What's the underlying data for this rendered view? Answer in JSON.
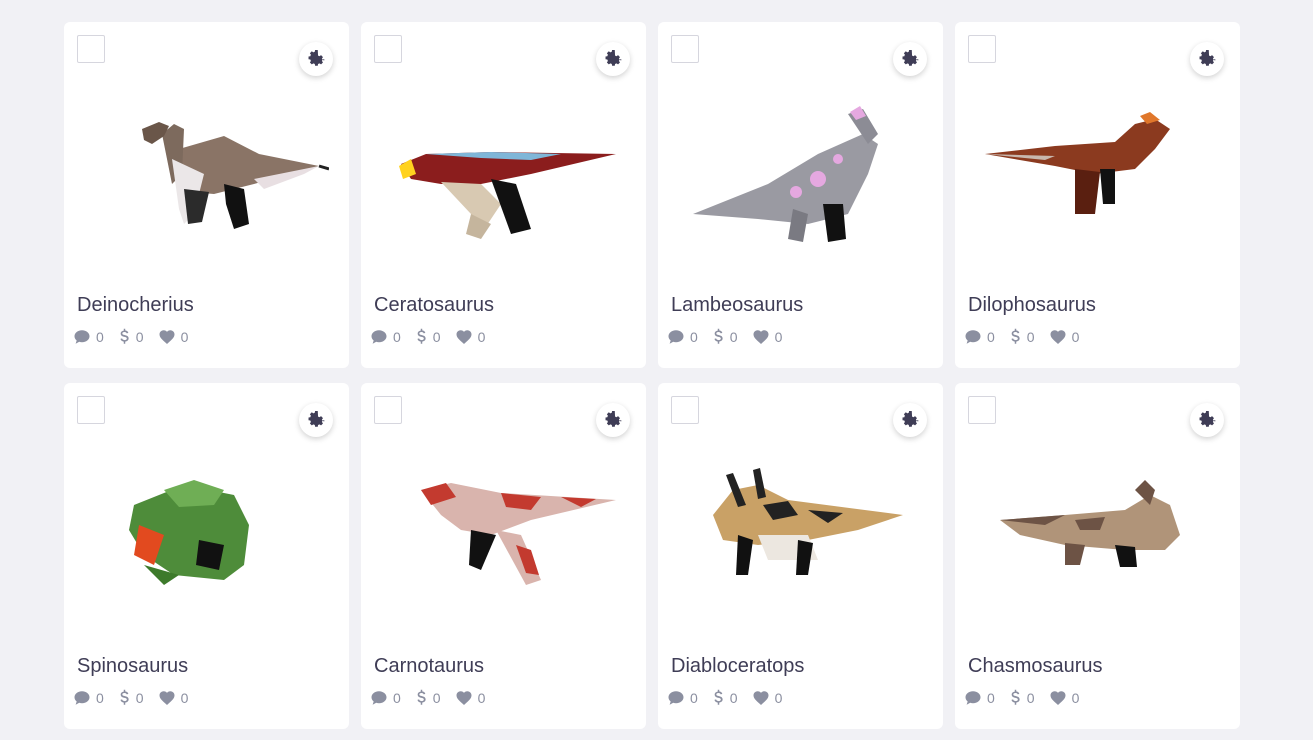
{
  "cards": [
    {
      "name": "Deinocherius",
      "comments": "0",
      "tips": "0",
      "likes": "0"
    },
    {
      "name": "Ceratosaurus",
      "comments": "0",
      "tips": "0",
      "likes": "0"
    },
    {
      "name": "Lambeosaurus",
      "comments": "0",
      "tips": "0",
      "likes": "0"
    },
    {
      "name": "Dilophosaurus",
      "comments": "0",
      "tips": "0",
      "likes": "0"
    },
    {
      "name": "Spinosaurus",
      "comments": "0",
      "tips": "0",
      "likes": "0"
    },
    {
      "name": "Carnotaurus",
      "comments": "0",
      "tips": "0",
      "likes": "0"
    },
    {
      "name": "Diabloceratops",
      "comments": "0",
      "tips": "0",
      "likes": "0"
    },
    {
      "name": "Chasmosaurus",
      "comments": "0",
      "tips": "0",
      "likes": "0"
    }
  ],
  "colors": {
    "background": "#f1f1f5",
    "card": "#ffffff",
    "gear": "#3f3d56",
    "stat_icons": "#8b8fa0"
  },
  "icons": {
    "settings": "gear-icon",
    "comments": "comment-icon",
    "tips": "dollar-icon",
    "likes": "heart-icon"
  }
}
